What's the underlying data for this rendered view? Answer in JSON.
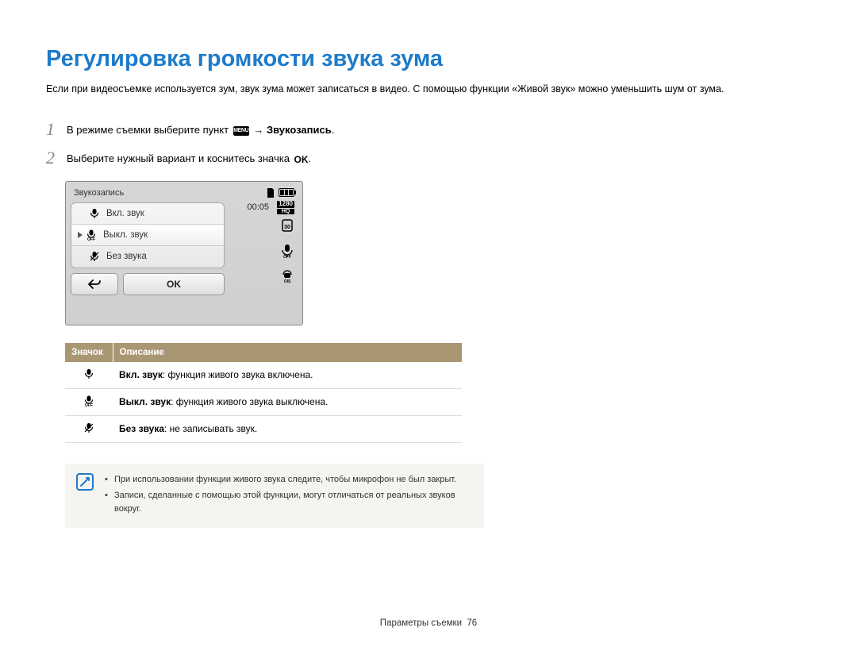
{
  "title": "Регулировка громкости звука зума",
  "intro": "Если при видеосъемке используется зум, звук зума может записаться в видео. С помощью функции «Живой звук» можно уменьшить шум от зума.",
  "steps": {
    "s1": {
      "num": "1",
      "pre": "В режиме съемки выберите пункт ",
      "menu": "MENU",
      "arrow": "→",
      "target": "Звукозапись",
      "period": "."
    },
    "s2": {
      "num": "2",
      "pre": "Выберите нужный вариант и коснитесь значка ",
      "ok": "OK",
      "period": "."
    }
  },
  "camera": {
    "panel_title": "Звукозапись",
    "time": "00:05",
    "res_top": "1280",
    "res_bottom": "HQ",
    "option1": "Вкл. звук",
    "option2": "Выкл. звук",
    "option3": "Без звука",
    "ok_label": "OK"
  },
  "table": {
    "h1": "Значок",
    "h2": "Описание",
    "row1_b": "Вкл. звук",
    "row1_t": ": функция живого звука включена.",
    "row2_b": "Выкл. звук",
    "row2_t": ": функция живого звука выключена.",
    "row3_b": "Без звука",
    "row3_t": ": не записывать звук."
  },
  "notes": {
    "n1": "При использовании функции живого звука следите, чтобы микрофон не был закрыт.",
    "n2": "Записи, сделанные с помощью этой функции, могут отличаться от реальных звуков вокруг."
  },
  "footer": {
    "section": "Параметры съемки",
    "page": "76"
  }
}
